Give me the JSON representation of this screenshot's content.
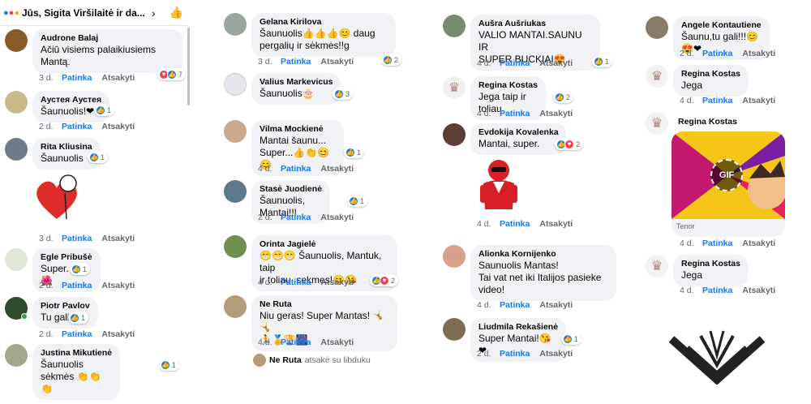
{
  "header": {
    "title": "Jūs, Sigita Viršilaitė ir da...",
    "chevron": "›"
  },
  "actions": {
    "like": "Patinka",
    "reply": "Atsakyti"
  },
  "columns": [
    [
      {
        "name": "Audrone Balaj",
        "text": "Ačiū visiems palaikiusiems\nMantą.",
        "age": "3 d.",
        "reactions": [
          "love",
          "like"
        ],
        "count": "7"
      },
      {
        "name": "Аустея Аустея",
        "text": "Šaunuolis!❤",
        "age": "2 d.",
        "reactions": [
          "like"
        ],
        "count": "1"
      },
      {
        "name": "Rita Kliusina",
        "text": "Šaunuolis",
        "age": "3 d.",
        "reactions": [
          "like"
        ],
        "count": "1"
      },
      {
        "name": "Egle Pribušė",
        "text": "Super.👍🌺",
        "age": "2 d.",
        "reactions": [
          "like"
        ],
        "count": "1"
      },
      {
        "name": "Piotr Pavlov",
        "text": "Tu gali 👍",
        "age": "2 d.",
        "reactions": [
          "like"
        ],
        "count": "1"
      },
      {
        "name": "Justina Mikutienė",
        "text": "Šaunuolis sėkmės 👏👏👏",
        "age": "",
        "reactions": [
          "like"
        ],
        "count": "1"
      }
    ],
    [
      {
        "name": "Gelana Kirilova",
        "text": "Šaunuolis👍👍👍😊 daug\npergalių ir sėkmės!!g",
        "age": "3 d.",
        "reactions": [
          "like"
        ],
        "count": "2"
      },
      {
        "name": "Valius Markevicus",
        "text": "Šaunuolis🎂",
        "age": "",
        "reactions": [
          "like"
        ],
        "count": "3"
      },
      {
        "name": "Vilma Mockienė",
        "text": "Mantai šaunu...\nSuper...👍👏😊😊",
        "age": "4 d.",
        "reactions": [
          "like"
        ],
        "count": "1"
      },
      {
        "name": "Stasė Juodienė",
        "text": "Šaunuolis, Mantai!!!",
        "age": "2 d.",
        "reactions": [
          "like"
        ],
        "count": "1"
      },
      {
        "name": "Orinta Jagielė",
        "text": "😁😁😁 Šaunuolis, Mantuk, taip\nir toliau, sekmes!😊😘",
        "age": "4 d.",
        "reactions": [
          "like",
          "love"
        ],
        "count": "2"
      },
      {
        "name": "Ne Ruta",
        "text": "Niu geras! Super Mantas! 🤸🤸\n🏃🏅🏆🎆",
        "age": "4 d.",
        "reactions": [],
        "count": ""
      }
    ],
    [
      {
        "name": "Aušra Aušriukas",
        "text": "VALIO MANTAI.SAUNU IR\nSUPER BUCKIAI😍",
        "age": "4 d.",
        "reactions": [
          "like"
        ],
        "count": "1"
      },
      {
        "name": "Regina Kostas",
        "text": "Jega taip ir toliau",
        "age": "4 d.",
        "reactions": [
          "like"
        ],
        "count": "2"
      },
      {
        "name": "Evdokija Kovalenka",
        "text": "Mantai, super.",
        "age": "4 d.",
        "reactions": [
          "like",
          "love"
        ],
        "count": "2"
      },
      {
        "name": "Alionka Kornijenko",
        "text": "Saunuolis Mantas!\nTai vat net iki Italijos pasieke\nvideo!",
        "age": "4 d.",
        "reactions": [],
        "count": ""
      },
      {
        "name": "Liudmila Rekašienė",
        "text": "Super Mantai!😘❤",
        "age": "2 d.",
        "reactions": [
          "like"
        ],
        "count": "1"
      }
    ],
    [
      {
        "name": "Angele Kontautiene",
        "text": "Šaunu,tu gali!!!😊😍❤",
        "age": "2 d.",
        "reactions": [],
        "count": ""
      },
      {
        "name": "Regina Kostas",
        "text": "Jega",
        "age": "4 d.",
        "reactions": [],
        "count": ""
      },
      {
        "name": "Regina Kostas",
        "text": "",
        "age": "4 d.",
        "reactions": [],
        "count": ""
      },
      {
        "name": "Regina Kostas",
        "text": "Jega",
        "age": "4 d.",
        "reactions": [],
        "count": ""
      }
    ]
  ],
  "reply_summary": {
    "name": "Ne Ruta",
    "text": "atsakė su libduku"
  },
  "gif": {
    "badge": "GIF",
    "source": "Tenor"
  },
  "colors": {
    "accent": "#1877f2",
    "bubble": "#f0f2f5",
    "muted": "#65676b",
    "love": "#f33e58"
  }
}
